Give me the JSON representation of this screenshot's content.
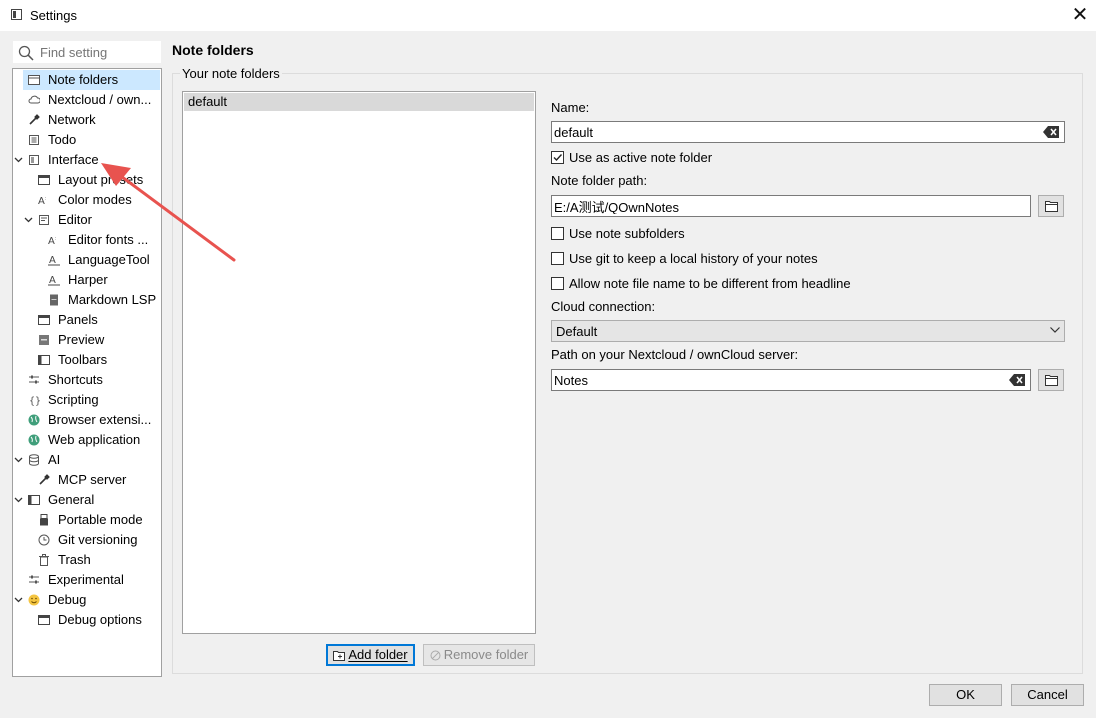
{
  "window": {
    "title": "Settings",
    "close_glyph": "✕"
  },
  "search": {
    "placeholder": "Find setting"
  },
  "tree": {
    "items": [
      {
        "label": "Note folders",
        "icon": "folder-note-icon",
        "depth": 0,
        "selected": true
      },
      {
        "label": "Nextcloud / own...",
        "icon": "cloud-icon",
        "depth": 0
      },
      {
        "label": "Network",
        "icon": "plug-icon",
        "depth": 0
      },
      {
        "label": "Todo",
        "icon": "todo-icon",
        "depth": 0
      },
      {
        "label": "Interface",
        "icon": "interface-icon",
        "depth": 0,
        "expanded": true
      },
      {
        "label": "Layout presets",
        "icon": "layout-icon",
        "depth": 1
      },
      {
        "label": "Color modes",
        "icon": "color-icon",
        "depth": 1
      },
      {
        "label": "Editor",
        "icon": "editor-icon",
        "depth": 1,
        "expanded": true
      },
      {
        "label": "Editor fonts ...",
        "icon": "font-icon",
        "depth": 2
      },
      {
        "label": "LanguageTool",
        "icon": "spell-icon",
        "depth": 2
      },
      {
        "label": "Harper",
        "icon": "spell-icon",
        "depth": 2
      },
      {
        "label": "Markdown LSP",
        "icon": "lsp-icon",
        "depth": 2
      },
      {
        "label": "Panels",
        "icon": "panels-icon",
        "depth": 1
      },
      {
        "label": "Preview",
        "icon": "preview-icon",
        "depth": 1
      },
      {
        "label": "Toolbars",
        "icon": "toolbars-icon",
        "depth": 1
      },
      {
        "label": "Shortcuts",
        "icon": "shortcuts-icon",
        "depth": 0
      },
      {
        "label": "Scripting",
        "icon": "scripting-icon",
        "depth": 0
      },
      {
        "label": "Browser extensi...",
        "icon": "globe-icon",
        "depth": 0
      },
      {
        "label": "Web application",
        "icon": "globe-icon",
        "depth": 0
      },
      {
        "label": "AI",
        "icon": "database-icon",
        "depth": 0,
        "expanded": true
      },
      {
        "label": "MCP server",
        "icon": "plug-icon",
        "depth": 1
      },
      {
        "label": "General",
        "icon": "general-icon",
        "depth": 0,
        "expanded": true
      },
      {
        "label": "Portable mode",
        "icon": "usb-icon",
        "depth": 1
      },
      {
        "label": "Git versioning",
        "icon": "clock-icon",
        "depth": 1
      },
      {
        "label": "Trash",
        "icon": "trash-icon",
        "depth": 1
      },
      {
        "label": "Experimental",
        "icon": "shortcuts-icon",
        "depth": 0
      },
      {
        "label": "Debug",
        "icon": "smiley-icon",
        "depth": 0,
        "expanded": true
      },
      {
        "label": "Debug options",
        "icon": "panels-icon",
        "depth": 1
      }
    ]
  },
  "main": {
    "title": "Note folders",
    "group_label": "Your note folders",
    "folders": [
      "default"
    ],
    "add_folder": "Add folder",
    "remove_folder": "Remove folder",
    "form": {
      "name_label": "Name:",
      "name_value": "default",
      "active_label": "Use as active note folder",
      "active_checked": true,
      "path_label": "Note folder path:",
      "path_value": "E:/A测试/QOwnNotes",
      "subfolders_label": "Use note subfolders",
      "git_label": "Use git to keep a local history of your notes",
      "filename_label": "Allow note file name to be different from headline",
      "cloud_label": "Cloud connection:",
      "cloud_value": "Default",
      "server_path_label": "Path on your Nextcloud / ownCloud server:",
      "server_path_value": "Notes"
    }
  },
  "footer": {
    "ok": "OK",
    "cancel": "Cancel"
  },
  "colors": {
    "selection": "#cce8ff",
    "accent": "#0078d7",
    "arrow": "#e8534f"
  }
}
